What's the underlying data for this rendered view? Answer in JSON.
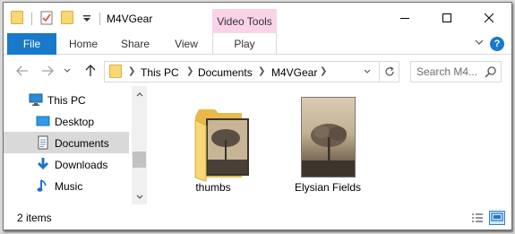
{
  "window": {
    "title": "M4VGear",
    "contextual_tab_group": "Video Tools",
    "contextual_color": "#fbd3e9",
    "minimize_label": "minimize",
    "maximize_label": "maximize",
    "close_label": "close"
  },
  "ribbon": {
    "tabs": [
      "File",
      "Home",
      "Share",
      "View",
      "Play"
    ],
    "file_color": "#1979ca",
    "help_label": "?"
  },
  "address": {
    "crumbs": [
      "This PC",
      "Documents",
      "M4VGear"
    ]
  },
  "search": {
    "placeholder": "Search M4..."
  },
  "nav_pane": {
    "items": [
      {
        "label": "This PC",
        "icon": "pc-icon"
      },
      {
        "label": "Desktop",
        "icon": "desktop-icon"
      },
      {
        "label": "Documents",
        "icon": "documents-icon",
        "selected": true
      },
      {
        "label": "Downloads",
        "icon": "downloads-icon"
      },
      {
        "label": "Music",
        "icon": "music-icon"
      }
    ]
  },
  "files": [
    {
      "name": "thumbs",
      "type": "folder"
    },
    {
      "name": "Elysian Fields",
      "type": "video"
    }
  ],
  "status": {
    "item_count": "2 items"
  }
}
